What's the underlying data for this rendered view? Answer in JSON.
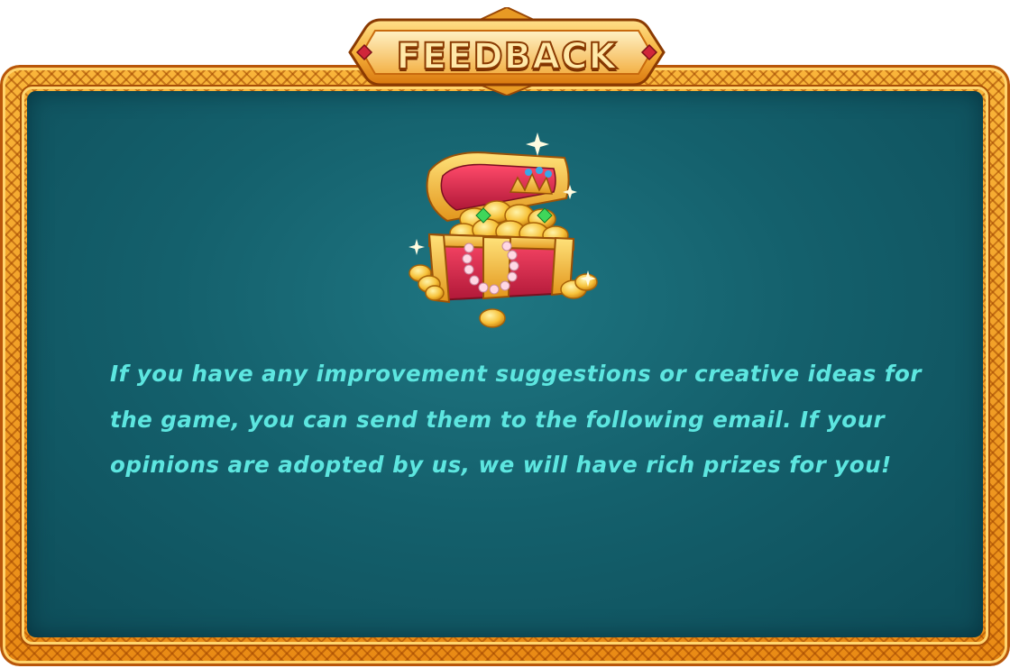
{
  "dialog": {
    "title": "FEEDBACK",
    "message": "If you have any improvement suggestions or creative ideas for the game, you can send them to the following email. If your opinions are adopted by us, we will have rich prizes for you!"
  },
  "icons": {
    "illustration": "treasure-chest-icon"
  },
  "colors": {
    "frame_gold": "#f2a22a",
    "panel_teal": "#14606c",
    "message_text": "#5de6e0",
    "title_text": "#ffe9a8"
  }
}
